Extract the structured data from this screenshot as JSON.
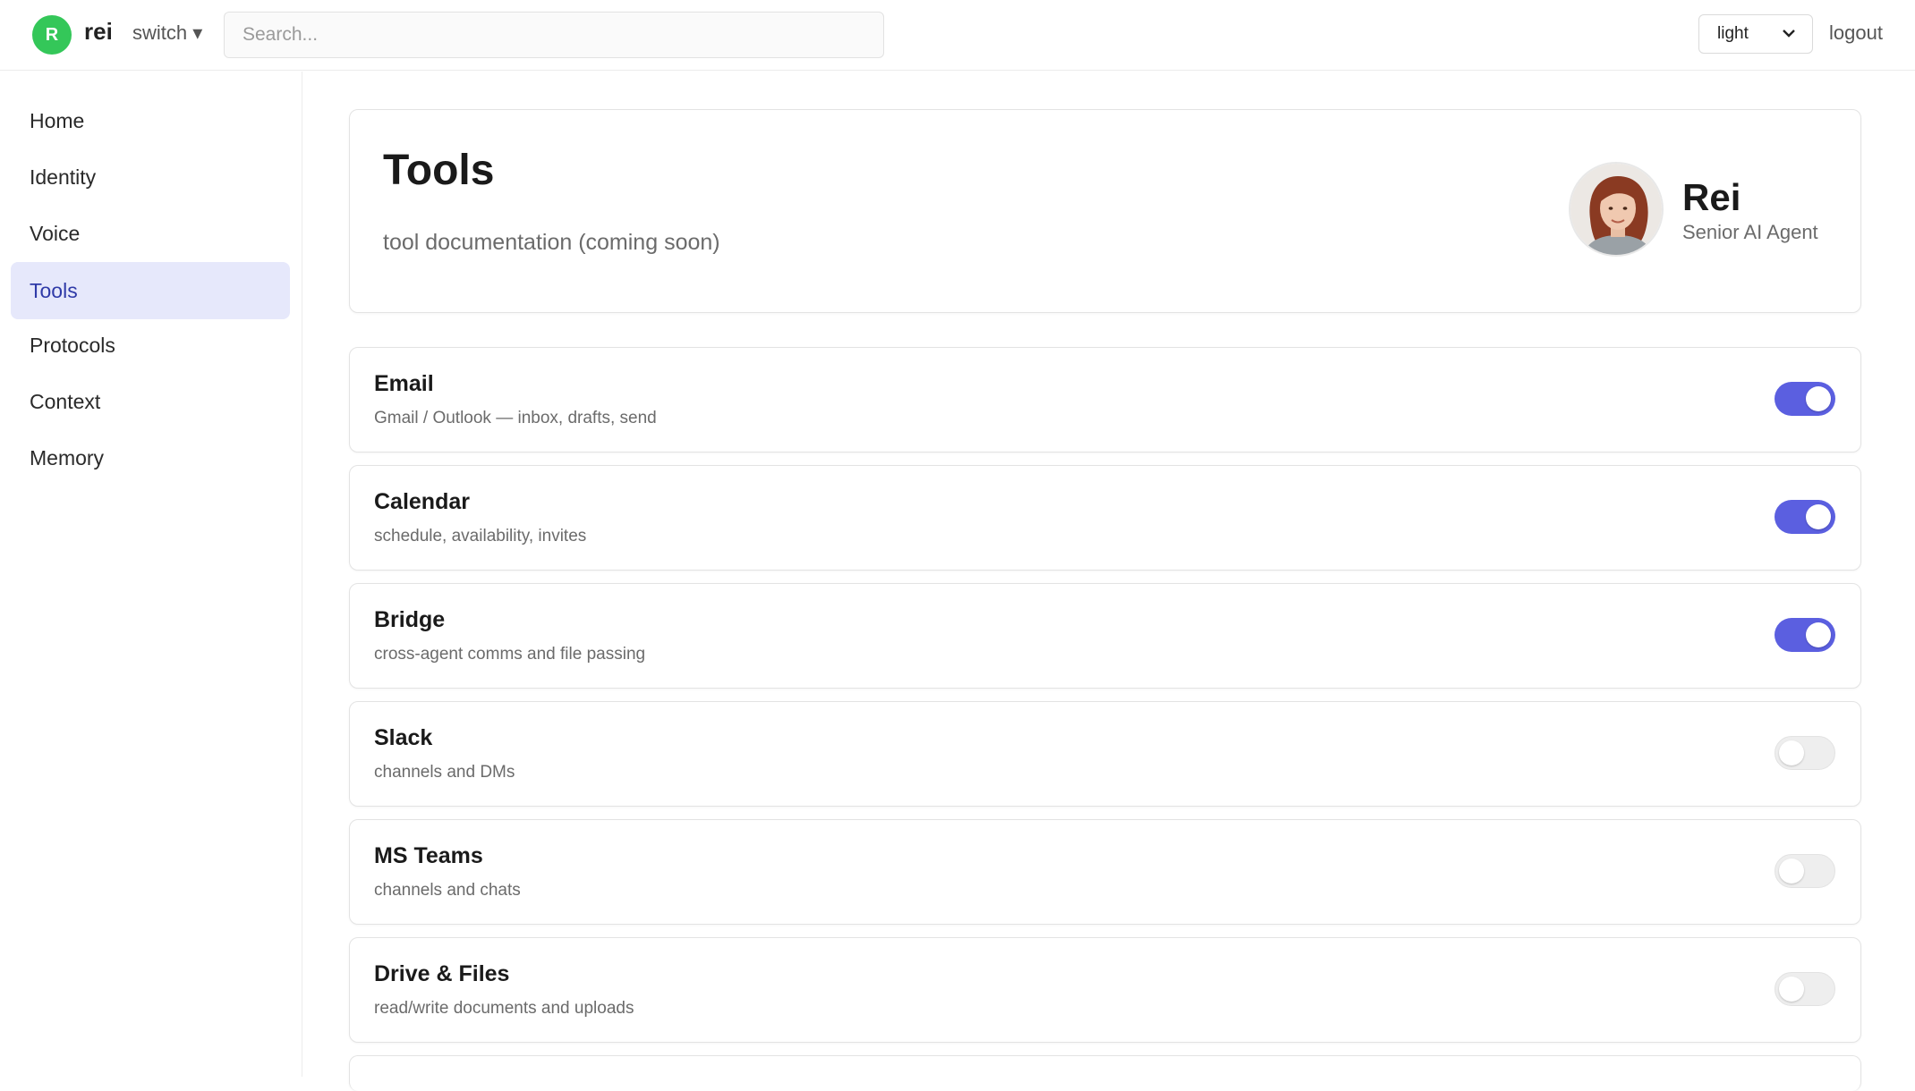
{
  "topbar": {
    "avatar_letter": "R",
    "username": "rei",
    "switch_label": "switch ▾",
    "search_placeholder": "Search...",
    "theme_value": "light",
    "logout_label": "logout"
  },
  "sidebar": {
    "items": [
      {
        "label": "Home",
        "active": false
      },
      {
        "label": "Identity",
        "active": false
      },
      {
        "label": "Voice",
        "active": false
      },
      {
        "label": "Tools",
        "active": true
      },
      {
        "label": "Protocols",
        "active": false
      },
      {
        "label": "Context",
        "active": false
      },
      {
        "label": "Memory",
        "active": false
      }
    ]
  },
  "header": {
    "title": "Tools",
    "subtitle": "tool documentation (coming soon)",
    "agent_name": "Rei",
    "agent_role": "Senior AI Agent"
  },
  "tools": [
    {
      "name": "Email",
      "desc": "Gmail / Outlook — inbox, drafts, send",
      "enabled": true
    },
    {
      "name": "Calendar",
      "desc": "schedule, availability, invites",
      "enabled": true
    },
    {
      "name": "Bridge",
      "desc": "cross-agent comms and file passing",
      "enabled": true
    },
    {
      "name": "Slack",
      "desc": "channels and DMs",
      "enabled": false
    },
    {
      "name": "MS Teams",
      "desc": "channels and chats",
      "enabled": false
    },
    {
      "name": "Drive & Files",
      "desc": "read/write documents and uploads",
      "enabled": false
    }
  ],
  "colors": {
    "accent": "#5b5fe0",
    "avatar_green": "#34c759",
    "active_nav_bg": "#e6e8fb"
  }
}
